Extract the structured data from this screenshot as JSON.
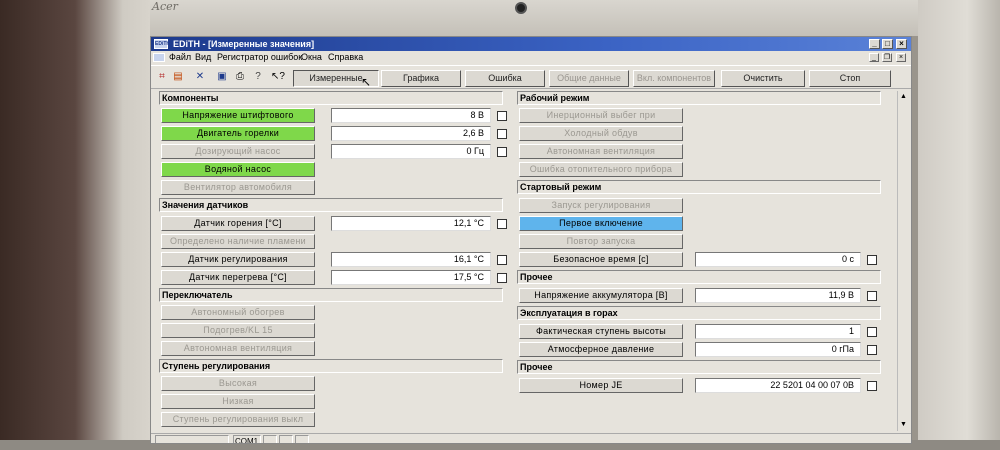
{
  "bezel": {
    "logo": "Acer"
  },
  "window": {
    "icon": "EDiTH",
    "title": "EDiTH - [Измеренные значения]"
  },
  "menu": [
    "Файл",
    "Вид",
    "Регистратор ошибок",
    "Окна",
    "Справка"
  ],
  "toolbar": {
    "buttons": [
      "Измеренные значения",
      "Графика",
      "Ошибка",
      "Общие данные",
      "Вкл. компонентов",
      "Очистить",
      "Стоп"
    ]
  },
  "left": {
    "components": {
      "title": "Компоненты",
      "items": [
        {
          "label": "Напряжение штифтового",
          "value": "8 В"
        },
        {
          "label": "Двигатель горелки",
          "value": "2,6 В"
        },
        {
          "label": "Дозирующий насос",
          "value": "0 Гц"
        },
        {
          "label": "Водяной насос"
        },
        {
          "label": "Вентилятор автомобиля"
        }
      ]
    },
    "sensors": {
      "title": "Значения датчиков",
      "items": [
        {
          "label": "Датчик горения [°C]",
          "value": "12,1 °C"
        },
        {
          "label": "Определено наличие пламени"
        },
        {
          "label": "Датчик регулирования",
          "value": "16,1 °C"
        },
        {
          "label": "Датчик перегрева [°C]",
          "value": "17,5 °C"
        }
      ]
    },
    "switches": {
      "title": "Переключатель",
      "items": [
        "Автономный обогрев",
        "Подогрев/KL 15",
        "Автономная вентиляция"
      ]
    },
    "stage": {
      "title": "Ступень регулирования",
      "items": [
        "Высокая",
        "Низкая",
        "Ступень регулирования выкл"
      ]
    }
  },
  "right": {
    "mode": {
      "title": "Рабочий режим",
      "items": [
        "Инерционный выбег при",
        "Холодный обдув",
        "Автономная вентиляция",
        "Ошибка отопительного прибора"
      ]
    },
    "start": {
      "title": "Стартовый режим",
      "items": [
        "Запуск регулирования",
        "Первое включение",
        "Повтор запуска"
      ],
      "safety": {
        "label": "Безопасное время [с]",
        "value": "0 с"
      }
    },
    "other": {
      "title": "Прочее",
      "battery": {
        "label": "Напряжение аккумулятора [В]",
        "value": "11,9 В"
      }
    },
    "mountain": {
      "title": "Эксплуатация в горах",
      "altitude": {
        "label": "Фактическая ступень высоты",
        "value": "1"
      },
      "pressure": {
        "label": "Атмосферное давление",
        "value": "0 гПа"
      }
    },
    "other2": {
      "title": "Прочее",
      "je": {
        "label": "Номер JE",
        "value": "22 5201 04 00 07 0В"
      }
    }
  },
  "status": {
    "port": "COM1"
  },
  "colors": {
    "active_green": "#7fd84a",
    "active_blue": "#5fb4ec",
    "title_blue": "#1d3a8c"
  }
}
